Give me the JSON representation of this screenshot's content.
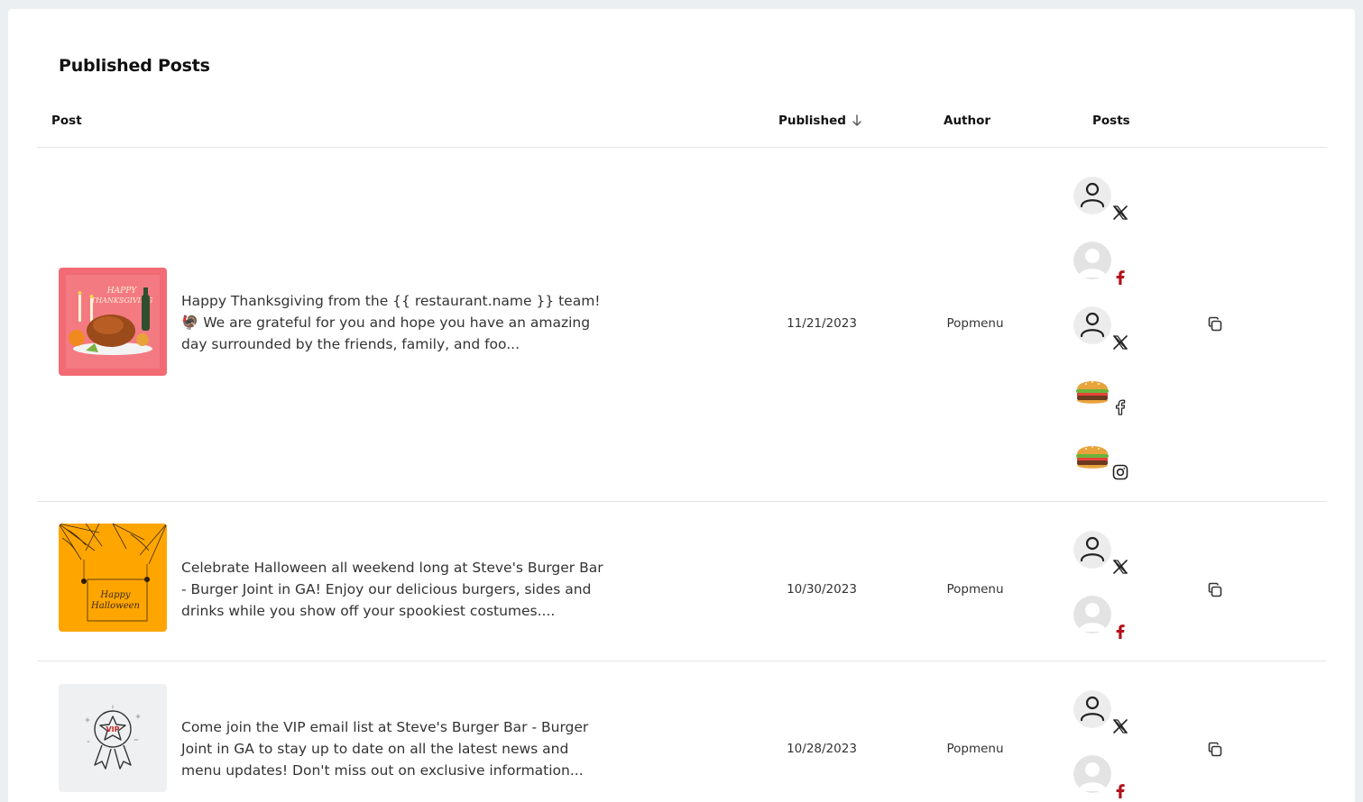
{
  "page": {
    "title": "Published Posts"
  },
  "table": {
    "headers": {
      "post": "Post",
      "published": "Published",
      "author": "Author",
      "posts": "Posts"
    }
  },
  "rows": [
    {
      "text": "Happy Thanksgiving from the {{ restaurant.name }} team! 🦃 We are grateful for you and hope you have an amazing day surrounded by the friends, family, and foo...",
      "published": "11/21/2023",
      "author": "Popmenu",
      "accounts": [
        {
          "avatar": "user-outline",
          "network": "x"
        },
        {
          "avatar": "user-gray",
          "network": "facebook-red"
        },
        {
          "avatar": "user-outline",
          "network": "x"
        },
        {
          "avatar": "burger",
          "network": "facebook-outline"
        },
        {
          "avatar": "burger",
          "network": "instagram"
        }
      ]
    },
    {
      "text": "Celebrate Halloween all weekend long at Steve's Burger Bar - Burger Joint in GA! Enjoy our delicious burgers, sides and drinks while you show off your spookiest costumes....",
      "published": "10/30/2023",
      "author": "Popmenu",
      "accounts": [
        {
          "avatar": "user-outline",
          "network": "x"
        },
        {
          "avatar": "user-gray",
          "network": "facebook-red"
        }
      ]
    },
    {
      "text": "Come join the VIP email list at Steve's Burger Bar - Burger Joint in GA to stay up to date on all the latest news and menu updates! Don't miss out on exclusive information...",
      "published": "10/28/2023",
      "author": "Popmenu",
      "accounts": [
        {
          "avatar": "user-outline",
          "network": "x"
        },
        {
          "avatar": "user-gray",
          "network": "facebook-red"
        }
      ]
    }
  ],
  "thumbs": {
    "thanksgiving": {
      "text_lines": [
        "HAPPY",
        "THANKSGIVING"
      ],
      "bg": "#f26a74"
    },
    "halloween": {
      "text_lines": [
        "Happy",
        "Halloween"
      ],
      "bg": "#ffa500"
    },
    "vip": {
      "text": "VIP",
      "bg": "#eef0f2"
    }
  },
  "colors": {
    "facebook_red": "#b3121c",
    "text": "#333333"
  }
}
